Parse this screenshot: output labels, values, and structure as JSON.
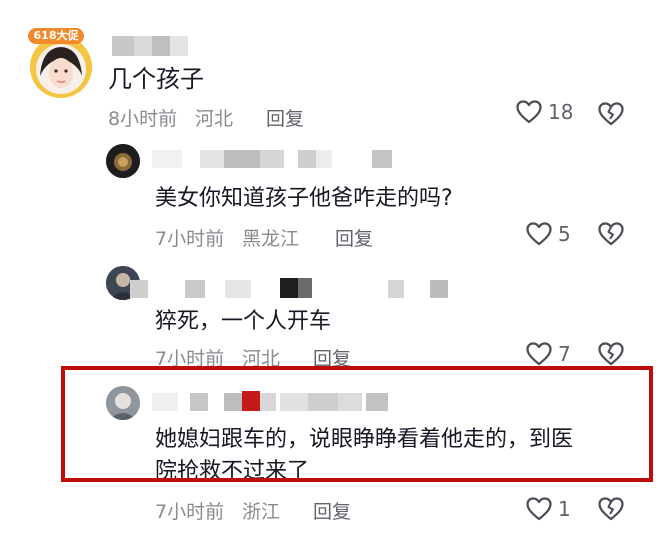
{
  "colors": {
    "highlight": "#c00b0b",
    "meta": "#8a8b91",
    "text": "#161823"
  },
  "main_comment": {
    "badge": "618大促",
    "text": "几个孩子",
    "time": "8小时前",
    "location": "河北",
    "reply_label": "回复",
    "likes": "18"
  },
  "replies": [
    {
      "text": "美女你知道孩子他爸咋走的吗?",
      "time": "7小时前",
      "location": "黑龙江",
      "reply_label": "回复",
      "likes": "5"
    },
    {
      "text": "猝死，一个人开车",
      "time": "7小时前",
      "location": "河北",
      "reply_label": "回复",
      "likes": "7"
    },
    {
      "text_line1": "她媳妇跟车的，说眼睁睁看着他走的，到医",
      "text_line2": "院抢救不过来了",
      "time": "7小时前",
      "location": "浙江",
      "reply_label": "回复",
      "likes": "1"
    }
  ],
  "icons": [
    "heart-icon",
    "broken-heart-icon"
  ]
}
